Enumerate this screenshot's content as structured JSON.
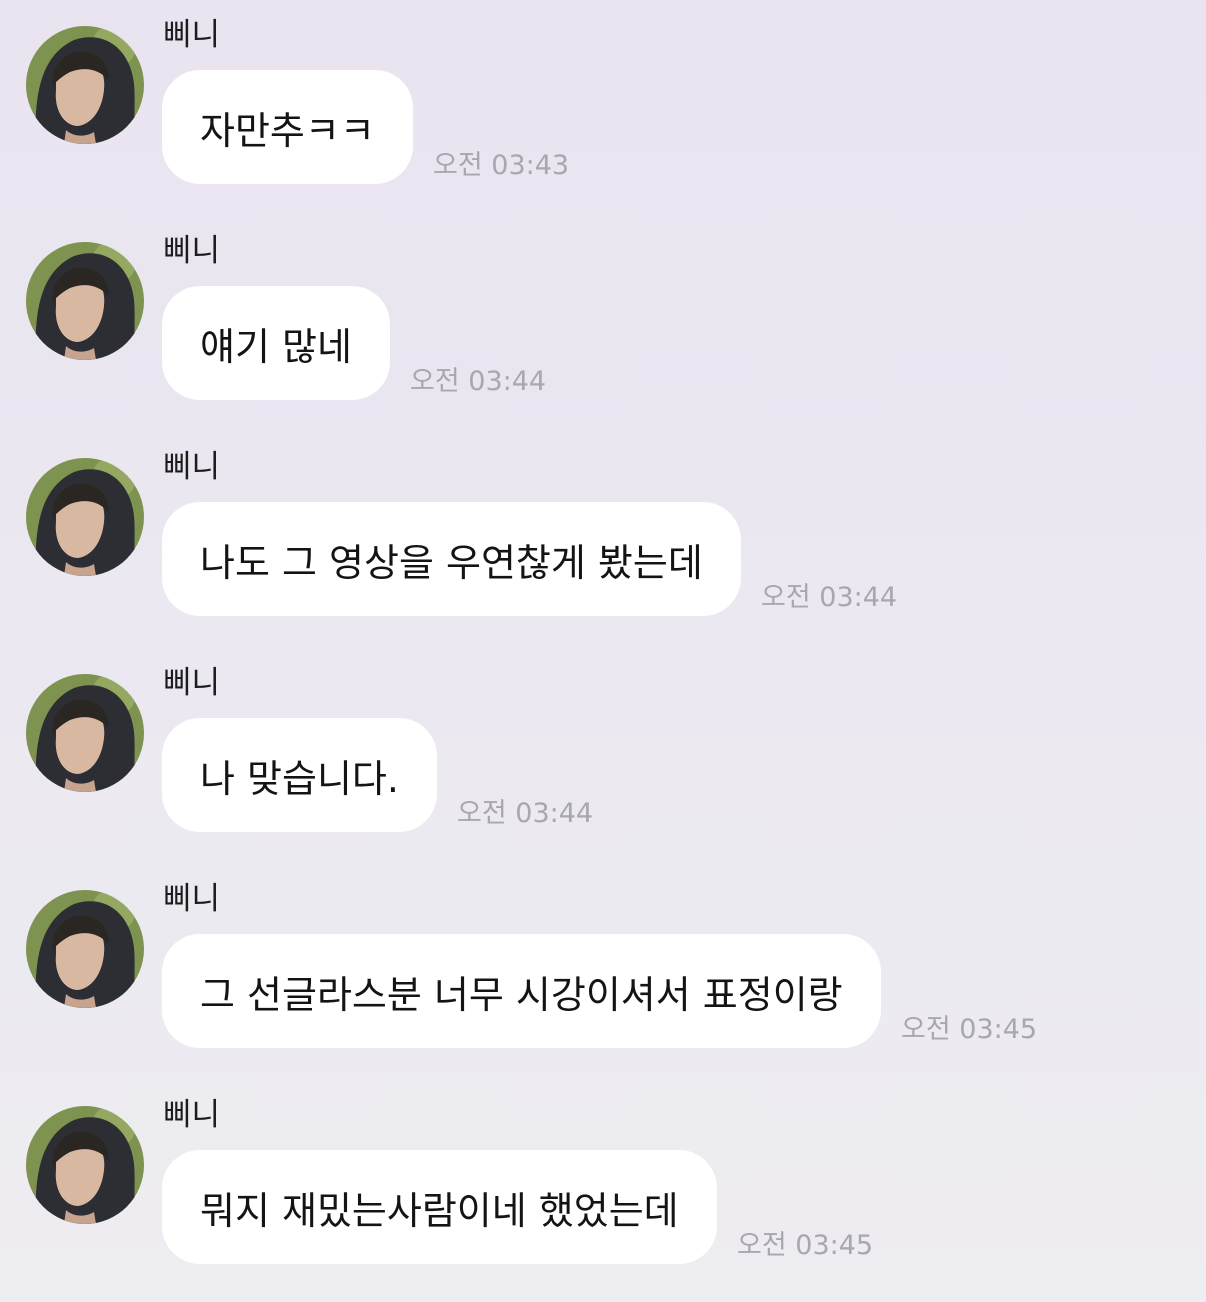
{
  "messages": [
    {
      "sender": "삐니",
      "text": "자만추ㅋㅋ",
      "time": "오전 03:43"
    },
    {
      "sender": "삐니",
      "text": "얘기 많네",
      "time": "오전 03:44"
    },
    {
      "sender": "삐니",
      "text": "나도 그 영상을 우연찮게 봤는데",
      "time": "오전 03:44"
    },
    {
      "sender": "삐니",
      "text": "나 맞습니다.",
      "time": "오전 03:44"
    },
    {
      "sender": "삐니",
      "text": "그 선글라스분 너무 시강이셔서 표정이랑",
      "time": "오전 03:45"
    },
    {
      "sender": "삐니",
      "text": "뭐지 재밌는사람이네 했었는데",
      "time": "오전 03:45"
    }
  ],
  "colors": {
    "bubble": "#ffffff",
    "timestamp": "#a9a7ae",
    "background": "#ebe8f1"
  }
}
